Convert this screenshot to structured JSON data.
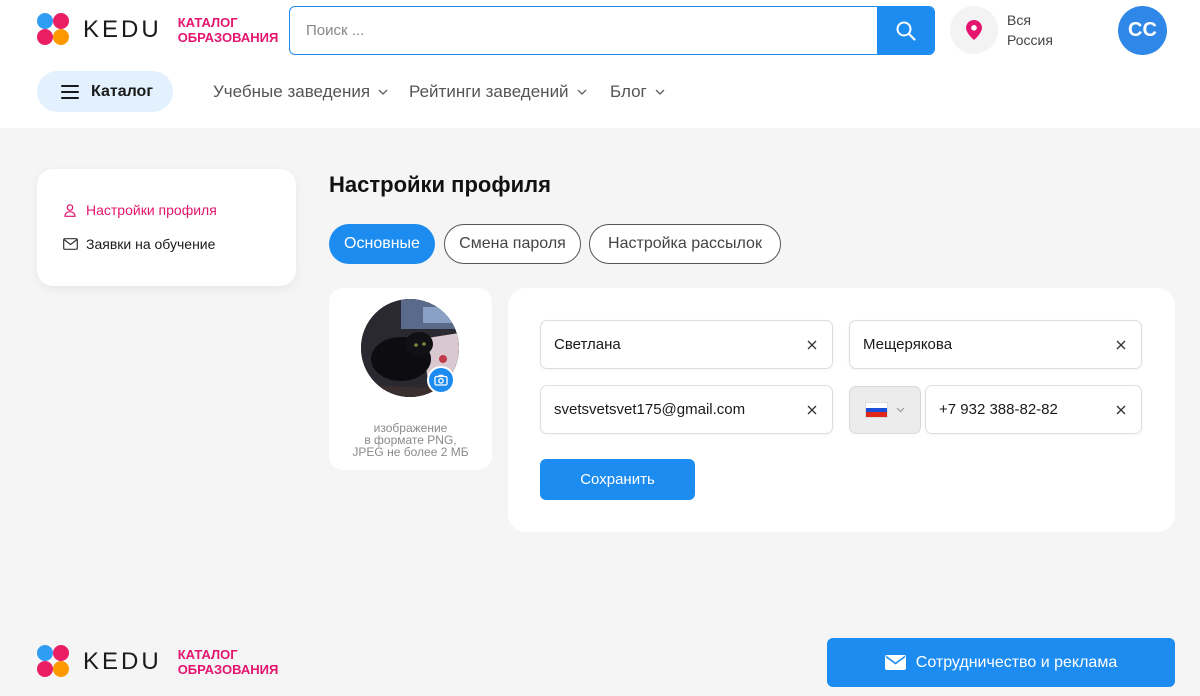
{
  "brand": {
    "name": "KEDU",
    "tagline_line1": "КАТАЛОГ",
    "tagline_line2": "ОБРАЗОВАНИЯ",
    "colors": {
      "blue": "#2f9df4",
      "pink": "#e91e63",
      "orange": "#ff9800",
      "accent": "#1d8cf0",
      "tagline": "#e3156f"
    }
  },
  "header": {
    "search": {
      "placeholder": "Поиск ...",
      "value": "",
      "icon": "search-icon"
    },
    "location": {
      "line1": "Вся",
      "line2": "Россия",
      "icon": "map-pin-icon"
    },
    "user": {
      "initials": "СС"
    }
  },
  "nav": {
    "catalog_label": "Каталог",
    "items": [
      {
        "label": "Учебные заведения"
      },
      {
        "label": "Рейтинги заведений"
      },
      {
        "label": "Блог"
      }
    ]
  },
  "sidebar": {
    "items": [
      {
        "label": "Настройки профиля",
        "icon": "user-icon",
        "active": true
      },
      {
        "label": "Заявки на обучение",
        "icon": "mail-icon",
        "active": false
      }
    ]
  },
  "page": {
    "title": "Настройки профиля",
    "tabs": [
      {
        "label": "Основные",
        "active": true
      },
      {
        "label": "Смена пароля",
        "active": false
      },
      {
        "label": "Настройка рассылок",
        "active": false
      }
    ]
  },
  "photo": {
    "hint_line1": "изображение",
    "hint_line2": "в формате PNG,",
    "hint_line3": "JPEG не более 2 МБ"
  },
  "form": {
    "first_name": "Светлана",
    "last_name": "Мещерякова",
    "email": "svetsvetsvet175@gmail.com",
    "country_flag": "russia-flag",
    "phone": "+7 932 388-82-82",
    "save_label": "Сохранить"
  },
  "footer": {
    "cooperation_label": "Сотрудничество и реклама"
  }
}
